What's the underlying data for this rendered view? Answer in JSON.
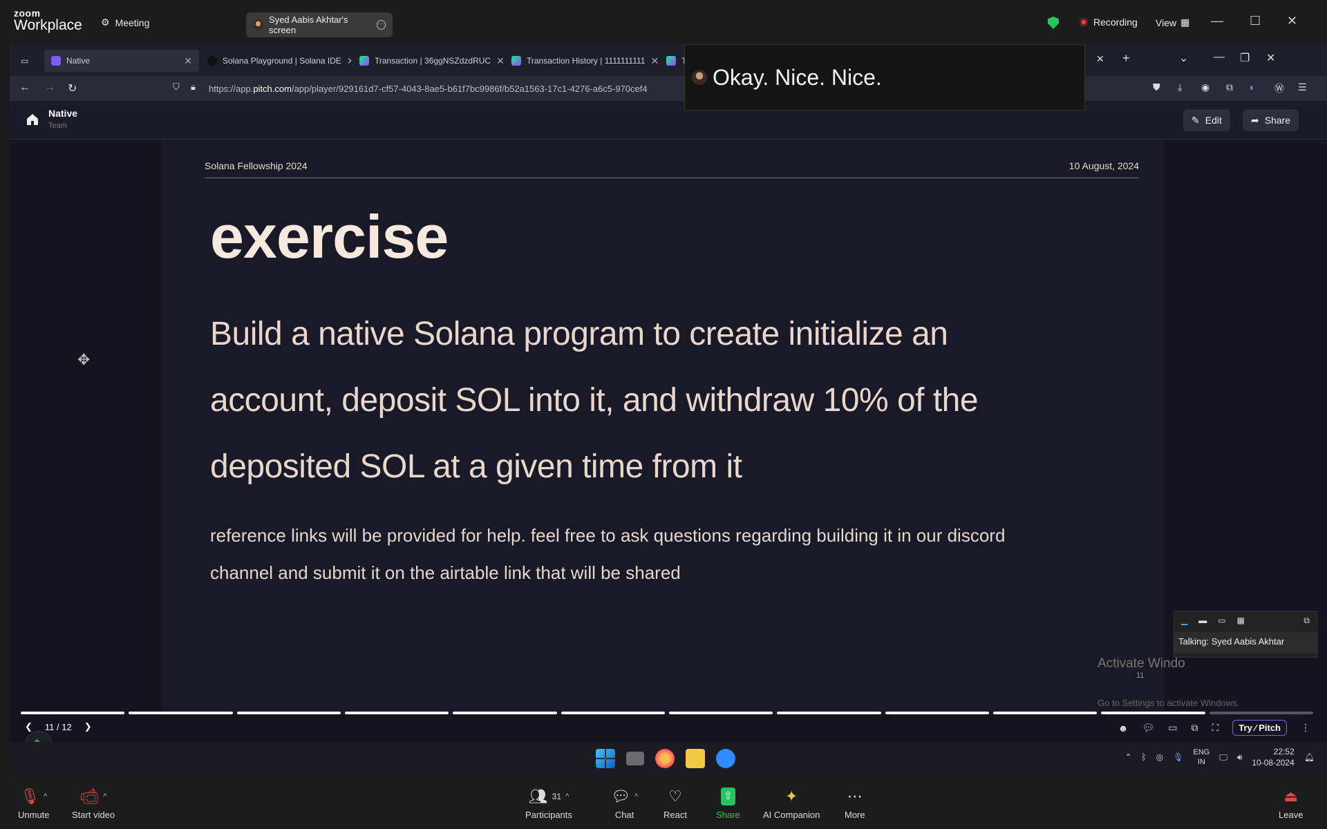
{
  "zoom": {
    "logo_top": "zoom",
    "logo_bottom": "Workplace",
    "meeting_label": "Meeting",
    "screen_share_label": "Syed Aabis Akhtar's screen",
    "recording_label": "Recording",
    "view_label": "View"
  },
  "browser": {
    "tabs": [
      {
        "label": "Native",
        "color": "#7c5cff"
      },
      {
        "label": "Solana Playground | Solana IDE",
        "color": "#111111"
      },
      {
        "label": "Transaction | 36ggNSZdzdRUC",
        "color": "#9945ff"
      },
      {
        "label": "Transaction History | 1111111111",
        "color": "#9945ff"
      },
      {
        "label": "Tra",
        "color": "#9945ff"
      }
    ],
    "url_prefix": "https://app.",
    "url_domain": "pitch.com",
    "url_rest": "/app/player/929161d7-cf57-4043-8ae5-b61f7bc9986f/b52a1563-17c1-4276-a6c5-970cef4"
  },
  "caption": {
    "text": "Okay. Nice. Nice."
  },
  "pitch": {
    "deck_name": "Native",
    "deck_team": "Team",
    "edit_label": "Edit",
    "share_label": "Share",
    "page_indicator": "11 / 12",
    "try_label": "Try",
    "pitch_label": "Pitch",
    "total_slides": 12,
    "current_slide": 11
  },
  "slide": {
    "top_left": "Solana Fellowship 2024",
    "top_right": "10 August, 2024",
    "title": "exercise",
    "body": "Build a native Solana program to create initialize an account, deposit SOL into it, and withdraw 10% of the deposited SOL at a given time from it",
    "note": "reference links will be provided for help. feel free to ask questions regarding building it in our discord channel and submit it on the airtable link that will be shared"
  },
  "overlay": {
    "page_small": "11",
    "activate_title": "Activate Windo",
    "activate_sub": "Go to Settings to activate Windows.",
    "talking": "Talking: Syed Aabis Akhtar"
  },
  "taskbar": {
    "lang_top": "ENG",
    "lang_bottom": "IN",
    "time": "22:52",
    "date": "10-08-2024"
  },
  "toolbar": {
    "unmute": "Unmute",
    "start_video": "Start video",
    "participants": "Participants",
    "participants_count": "31",
    "chat": "Chat",
    "react": "React",
    "share": "Share",
    "ai_companion": "AI Companion",
    "more": "More",
    "leave": "Leave"
  }
}
